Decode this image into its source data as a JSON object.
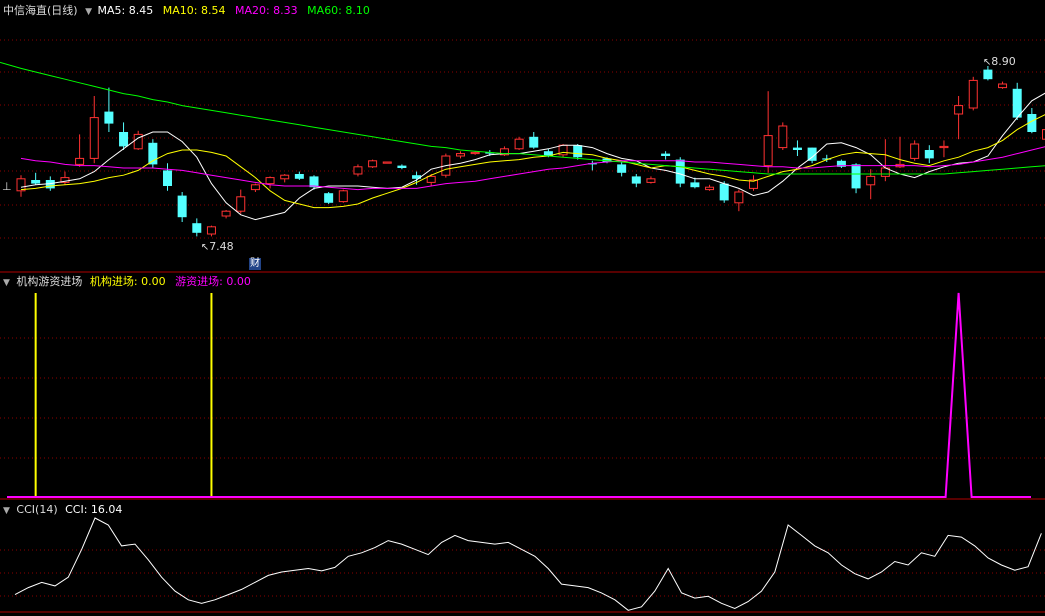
{
  "header": {
    "stock_title": "中信海直(日线)",
    "ma_items": [
      {
        "label": "MA5: 8.45",
        "color": "#ffffff"
      },
      {
        "label": "MA10: 8.54",
        "color": "#ffff00"
      },
      {
        "label": "MA20: 8.33",
        "color": "#ff00ff"
      },
      {
        "label": "MA60: 8.10",
        "color": "#00ff00"
      }
    ]
  },
  "indicator1": {
    "title": "机构游资进场",
    "items": [
      {
        "label": "机构进场: 0.00",
        "color": "#ffff00"
      },
      {
        "label": "游资进场: 0.00",
        "color": "#ff00ff"
      }
    ]
  },
  "indicator2": {
    "title": "CCI(14)",
    "items": [
      {
        "label": "CCI: 16.04",
        "color": "#ffffff"
      }
    ]
  },
  "annotations": {
    "high": "8.90",
    "low": "7.48",
    "cai": "财"
  },
  "colors": {
    "up": "#ff3232",
    "down": "#54ffff",
    "grid": "#8b0000",
    "ma5": "#ffffff",
    "ma10": "#ffff00",
    "ma20": "#ff00ff",
    "ma60": "#00ff00"
  },
  "chart_data": {
    "type": "candlestick",
    "price_ylim": [
      7.2,
      9.3
    ],
    "high_label": 8.9,
    "low_label": 7.48,
    "candles": [
      [
        7.86,
        7.96,
        7.99,
        7.81
      ],
      [
        7.95,
        7.92,
        8.01,
        7.91
      ],
      [
        7.95,
        7.88,
        7.98,
        7.86
      ],
      [
        7.93,
        7.97,
        8.02,
        7.91
      ],
      [
        8.08,
        8.13,
        8.33,
        8.06
      ],
      [
        8.13,
        8.47,
        8.65,
        8.09
      ],
      [
        8.52,
        8.42,
        8.72,
        8.35
      ],
      [
        8.35,
        8.23,
        8.43,
        8.2
      ],
      [
        8.21,
        8.33,
        8.36,
        8.2
      ],
      [
        8.26,
        8.08,
        8.29,
        8.05
      ],
      [
        8.03,
        7.9,
        8.09,
        7.86
      ],
      [
        7.82,
        7.64,
        7.85,
        7.6
      ],
      [
        7.59,
        7.51,
        7.63,
        7.48
      ],
      [
        7.5,
        7.56,
        7.57,
        7.48
      ],
      [
        7.65,
        7.69,
        7.7,
        7.63
      ],
      [
        7.69,
        7.81,
        7.87,
        7.67
      ],
      [
        7.87,
        7.91,
        7.92,
        7.85
      ],
      [
        7.92,
        7.97,
        7.98,
        7.88
      ],
      [
        7.96,
        7.99,
        8.0,
        7.93
      ],
      [
        8.0,
        7.96,
        8.02,
        7.95
      ],
      [
        7.98,
        7.89,
        7.99,
        7.87
      ],
      [
        7.84,
        7.76,
        7.85,
        7.75
      ],
      [
        7.77,
        7.86,
        7.87,
        7.76
      ],
      [
        8.0,
        8.06,
        8.08,
        7.98
      ],
      [
        8.06,
        8.11,
        8.12,
        8.05
      ],
      [
        8.09,
        8.1,
        8.1,
        8.09
      ],
      [
        8.07,
        8.05,
        8.08,
        8.04
      ],
      [
        7.99,
        7.96,
        8.02,
        7.91
      ],
      [
        7.93,
        7.98,
        8.0,
        7.9
      ],
      [
        7.99,
        8.15,
        8.17,
        7.97
      ],
      [
        8.15,
        8.17,
        8.19,
        8.13
      ],
      [
        8.17,
        8.18,
        8.19,
        8.16
      ],
      [
        8.18,
        8.17,
        8.2,
        8.15
      ],
      [
        8.16,
        8.21,
        8.23,
        8.15
      ],
      [
        8.21,
        8.29,
        8.31,
        8.2
      ],
      [
        8.31,
        8.22,
        8.35,
        8.21
      ],
      [
        8.19,
        8.15,
        8.21,
        8.14
      ],
      [
        8.16,
        8.24,
        8.25,
        8.14
      ],
      [
        8.24,
        8.14,
        8.25,
        8.12
      ],
      [
        8.09,
        8.08,
        8.11,
        8.03
      ],
      [
        8.13,
        8.1,
        8.14,
        8.09
      ],
      [
        8.08,
        8.01,
        8.1,
        7.98
      ],
      [
        7.98,
        7.92,
        8.0,
        7.89
      ],
      [
        7.93,
        7.96,
        7.98,
        7.92
      ],
      [
        8.17,
        8.15,
        8.19,
        8.12
      ],
      [
        8.12,
        7.92,
        8.14,
        7.89
      ],
      [
        7.93,
        7.89,
        7.97,
        7.88
      ],
      [
        7.87,
        7.89,
        7.91,
        7.86
      ],
      [
        7.92,
        7.78,
        7.94,
        7.76
      ],
      [
        7.76,
        7.85,
        7.87,
        7.69
      ],
      [
        7.88,
        7.95,
        7.99,
        7.86
      ],
      [
        8.07,
        8.32,
        8.69,
        8.01
      ],
      [
        8.22,
        8.4,
        8.43,
        8.2
      ],
      [
        8.22,
        8.2,
        8.28,
        8.15
      ],
      [
        8.22,
        8.11,
        8.22,
        8.09
      ],
      [
        8.13,
        8.12,
        8.16,
        8.1
      ],
      [
        8.11,
        8.06,
        8.12,
        8.05
      ],
      [
        8.08,
        7.88,
        8.09,
        7.84
      ],
      [
        7.91,
        7.98,
        8.04,
        7.79
      ],
      [
        7.98,
        8.05,
        8.29,
        7.94
      ],
      [
        8.06,
        8.08,
        8.31,
        8.05
      ],
      [
        8.13,
        8.25,
        8.28,
        8.11
      ],
      [
        8.2,
        8.13,
        8.24,
        8.09
      ],
      [
        8.22,
        8.23,
        8.28,
        8.14
      ],
      [
        8.5,
        8.57,
        8.65,
        8.29
      ],
      [
        8.55,
        8.78,
        8.81,
        8.53
      ],
      [
        8.87,
        8.79,
        8.9,
        8.78
      ],
      [
        8.72,
        8.75,
        8.77,
        8.71
      ],
      [
        8.71,
        8.47,
        8.76,
        8.45
      ],
      [
        8.5,
        8.35,
        8.55,
        8.34
      ],
      [
        8.29,
        8.37,
        8.41,
        8.29
      ],
      [
        8.36,
        8.22,
        8.43,
        8.21
      ],
      [
        8.44,
        8.47,
        8.49,
        8.28
      ],
      [
        8.46,
        8.4,
        8.62,
        8.25
      ]
    ],
    "series": [
      {
        "name": "MA5",
        "color": "#ffffff",
        "values": [
          7.89,
          7.91,
          7.92,
          7.94,
          7.96,
          8.02,
          8.12,
          8.21,
          8.3,
          8.35,
          8.35,
          8.27,
          8.14,
          7.92,
          7.76,
          7.66,
          7.62,
          7.65,
          7.68,
          7.8,
          7.88,
          7.9,
          7.9,
          7.9,
          7.89,
          7.88,
          7.89,
          7.95,
          8.04,
          8.07,
          8.09,
          8.12,
          8.16,
          8.17,
          8.17,
          8.19,
          8.21,
          8.24,
          8.24,
          8.22,
          8.17,
          8.13,
          8.11,
          8.05,
          8.03,
          8.0,
          7.96,
          7.96,
          7.92,
          7.88,
          7.82,
          7.85,
          7.94,
          8.05,
          8.14,
          8.25,
          8.26,
          8.22,
          8.16,
          8.05,
          8.0,
          7.97,
          8.02,
          8.06,
          8.09,
          8.1,
          8.15,
          8.32,
          8.47,
          8.61,
          8.68,
          8.75,
          8.67,
          8.56,
          8.46,
          8.4
        ]
      },
      {
        "name": "MA10",
        "color": "#ffff00",
        "values": [
          7.87,
          7.88,
          7.9,
          7.91,
          7.92,
          7.94,
          7.97,
          7.99,
          8.03,
          8.11,
          8.17,
          8.2,
          8.2,
          8.18,
          8.15,
          8.06,
          7.97,
          7.86,
          7.78,
          7.75,
          7.72,
          7.72,
          7.73,
          7.75,
          7.8,
          7.84,
          7.88,
          7.93,
          7.99,
          8.04,
          8.06,
          8.08,
          8.1,
          8.11,
          8.12,
          8.14,
          8.15,
          8.18,
          8.17,
          8.16,
          8.13,
          8.11,
          8.08,
          8.05,
          8.07,
          8.06,
          8.03,
          8.0,
          7.98,
          7.95,
          7.94,
          7.98,
          8.02,
          8.04,
          8.07,
          8.12,
          8.16,
          8.18,
          8.17,
          8.16,
          8.12,
          8.09,
          8.07,
          8.11,
          8.14,
          8.19,
          8.22,
          8.28,
          8.37,
          8.44,
          8.5,
          8.56,
          8.58,
          8.6,
          8.58,
          8.55
        ]
      },
      {
        "name": "MA20",
        "color": "#ff00ff",
        "values": [
          8.13,
          8.11,
          8.1,
          8.08,
          8.07,
          8.07,
          8.06,
          8.05,
          8.05,
          8.05,
          8.04,
          8.03,
          8.01,
          7.99,
          7.97,
          7.95,
          7.93,
          7.91,
          7.9,
          7.9,
          7.9,
          7.89,
          7.88,
          7.87,
          7.88,
          7.88,
          7.88,
          7.88,
          7.9,
          7.92,
          7.93,
          7.94,
          7.96,
          7.98,
          8.0,
          8.02,
          8.04,
          8.05,
          8.07,
          8.09,
          8.1,
          8.11,
          8.11,
          8.11,
          8.11,
          8.11,
          8.1,
          8.1,
          8.09,
          8.08,
          8.07,
          8.06,
          8.06,
          8.05,
          8.05,
          8.06,
          8.07,
          8.07,
          8.07,
          8.07,
          8.07,
          8.07,
          8.06,
          8.07,
          8.08,
          8.1,
          8.12,
          8.14,
          8.17,
          8.2,
          8.23,
          8.26,
          8.28,
          8.3,
          8.32,
          8.33
        ]
      },
      {
        "name": "MA60",
        "color": "#00ff00",
        "values": [
          8.88,
          8.85,
          8.82,
          8.79,
          8.76,
          8.73,
          8.7,
          8.67,
          8.65,
          8.62,
          8.6,
          8.57,
          8.55,
          8.53,
          8.51,
          8.49,
          8.47,
          8.45,
          8.43,
          8.41,
          8.39,
          8.37,
          8.35,
          8.33,
          8.31,
          8.29,
          8.27,
          8.25,
          8.23,
          8.22,
          8.2,
          8.19,
          8.18,
          8.17,
          8.17,
          8.16,
          8.15,
          8.14,
          8.13,
          8.12,
          8.11,
          8.1,
          8.09,
          8.08,
          8.07,
          8.06,
          8.05,
          8.04,
          8.03,
          8.02,
          8.01,
          8.0,
          8.0,
          8.0,
          8.0,
          8.0,
          8.0,
          8.0,
          8.0,
          8.0,
          8.0,
          8.0,
          8.0,
          8.0,
          8.01,
          8.02,
          8.03,
          8.04,
          8.05,
          8.06,
          8.07,
          8.08,
          8.08,
          8.09,
          8.09,
          8.1
        ]
      }
    ],
    "indicator1_signals": [
      {
        "series": "机构进场",
        "color": "#ffff00",
        "bar_indices": [
          1,
          13
        ]
      },
      {
        "series": "游资进场",
        "color": "#ff00ff",
        "spike_index": 64
      }
    ],
    "cci": [
      -160,
      -140,
      -125,
      -135,
      -110,
      -30,
      60,
      40,
      -20,
      -15,
      -60,
      -110,
      -150,
      -175,
      -185,
      -175,
      -160,
      -145,
      -125,
      -105,
      -95,
      -90,
      -85,
      -92,
      -82,
      -50,
      -40,
      -25,
      -5,
      -15,
      -30,
      -45,
      -10,
      10,
      -5,
      -10,
      -15,
      -10,
      -30,
      -50,
      -85,
      -130,
      -135,
      -140,
      -155,
      -175,
      -205,
      -195,
      -150,
      -85,
      -155,
      -170,
      -165,
      -185,
      -200,
      -180,
      -150,
      -95,
      40,
      10,
      -20,
      -40,
      -75,
      -100,
      -115,
      -95,
      -65,
      -75,
      -40,
      -50,
      10,
      5,
      -20,
      -55,
      -75,
      -90,
      -80,
      16
    ]
  }
}
